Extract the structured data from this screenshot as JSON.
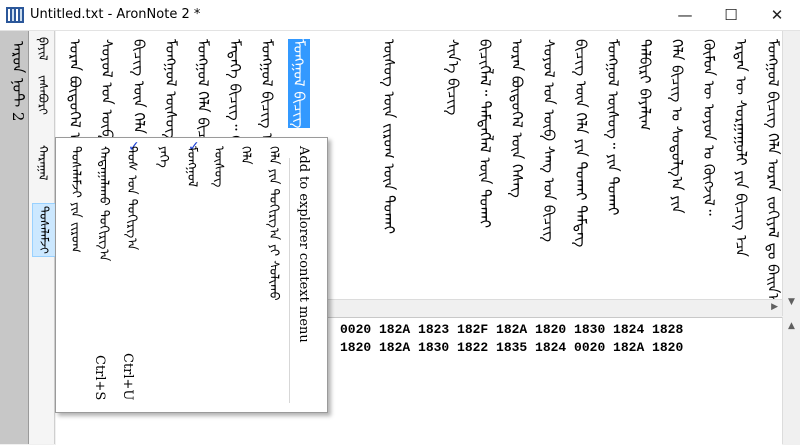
{
  "window": {
    "title": "Untitled.txt - AronNote 2 *",
    "minimize": "—",
    "maximize": "☐",
    "close": "✕"
  },
  "app": {
    "name": "ᠠᠷᠤᠨ ᠨᠣᠲ 2"
  },
  "menu": [
    "ᠹᠠᠶᠢᠯ",
    "ᠵᠠᠰᠠᠪᠤᠷᠢ",
    "ᠬᠠᠷᠠᠭᠠᠯ",
    "ᠲᠤᠰᠠᠯᠠᠮᠵᠢ"
  ],
  "editor": {
    "lines": [
      "ᠮᠣᠩᠭᠣᠯ ᠪᠢᠴᠢᠭ᠌ ᠬᠡᠯᠡ ᠤᠷᠠᠨ ᠵᠣᠬᠢᠶᠠᠯ ᠳᠤ ᠪᠠᠢᠨ᠎ᠠ",
      "ᠡᠷᠲᠡᠨ ᠦ ᠰᠤᠷᠭᠠᠭᠤᠯᠢ ᠶᠢᠨ ᠪᠢᠴᠢᠭ᠌ ᠡᠴᠡ",
      "ᠬᠦᠮᠦᠨ ᠦ ᠣᠶᠤᠨ ᠤ ᠬᠥᠭᠵᠢᠯ᠃",
      "ᠬᠡᠯᠡ ᠪᠢᠴᠢᠭ ᠤ ᠰᠤᠳᠤᠯᠭ᠎ᠠ ᠶᠢᠨ",
      "ᠲᠠᠯᠪᠢᠷᠢ ᠪᠠᠶᠠᠯᠢᠭ",
      "ᠮᠣᠩᠭᠣᠯ ᠦᠰᠦᠭ᠃ ᠶᠢᠨ ᠲᠤᠬᠠᠢ",
      "ᠪᠢᠴᠢᠭ ᠦᠨ ᠬᠡᠯᠡ ᠶᠢᠨ ᠲᠤᠬᠠᠢ ᠲᠡᠮᠳᠡᠭ",
      "ᠰᠣᠶᠣᠯ ᠤᠨ ᠥᠪ ᠰᠠᠩ ᠤᠨ ᠪᠢᠴᠢᠭ",
      "ᠤᠷᠠᠨ ᠪᠦᠲᠦᠭᠡᠯ ᠦᠨ ᠬᠡᠰᠡᠭ",
      "ᠪᠢᠴᠢᠭᠯᠡᠯ᠃ ᠲᠡᠮᠳᠡᠭᠯᠡᠯ ᠦᠨ ᠲᠤᠬᠠᠢ",
      "ᠰᠢᠨ᠎ᠡ ᠪᠢᠴᠢᠭ",
      "ᠦᠰᠦᠭ ᠦᠨ ᠵᠢᠷᠤᠭ ᠦᠨ ᠲᠤᠬᠠᠢ",
      "ᠮᠣᠩᠭᠣᠯ ᠪᠢᠴᠢᠭ ᠦᠨ",
      "ᠮᠡᠳᠡᠭᠡ ᠪᠢᠴᠢᠭ᠃ ᠬᠡᠷᠡᠭ",
      "ᠮᠣᠩᠭᠣᠯ ᠬᠡᠯᠡ ᠪᠢᠴᠢᠭ ᠦᠨ ᠰᠤᠷᠭᠠᠭᠤᠯᠢ ᠶᠢᠨ"
    ],
    "selected_line": "ᠮᠣᠩᠭᠣᠯ ᠪᠢᠴᠢᠭ"
  },
  "hex": {
    "lines": [
      "0020 182A 1823 182F 182A 1820 1830 1824 1828",
      "1820 182A 1830 1822 1835 1824 0020 182A 1820"
    ]
  },
  "context_menu": {
    "items": [
      {
        "label": "Add to explorer context menu",
        "shortcut": "",
        "checked": false
      },
      {
        "label": "ᠬᠡᠯᠡ ᠶᠢᠨ ᠲᠣᠬᠢᠷᠭ᠎ᠠ ᠶᠢ ᠰᠣᠯᠢᠬᠤ",
        "shortcut": "",
        "checked": false
      },
      {
        "label": "ᠬᠡᠯᠡ",
        "shortcut": "",
        "checked": false
      },
      {
        "label": "ᠦᠰᠦᠭ",
        "shortcut": "",
        "checked": false
      },
      {
        "label": "ᠮᠣᠩᠭᠣᠯ",
        "shortcut": "",
        "checked": true
      },
      {
        "label": "ᠶᠡᠬᠡ",
        "shortcut": "",
        "checked": false
      },
      {
        "label": "ᠳᠤᠰ ᠤᠨ ᠲᠣᠬᠢᠷᠭ᠎ᠠ",
        "shortcut": "Ctrl+U",
        "checked": true
      },
      {
        "label": "ᠬᠠᠳᠠᠭᠠᠯᠠᠬᠤ ᠲᠣᠬᠢᠷᠭ᠎ᠠ",
        "shortcut": "Ctrl+S",
        "checked": false
      },
      {
        "label": "ᠲᠤᠰᠠᠯᠠᠮᠵᠢ ᠶᠢᠨ ᠵᠢᠷᠤᠭ",
        "shortcut": "",
        "checked": false
      }
    ]
  },
  "icons": {
    "app": "app-icon",
    "check": "✓"
  },
  "colors": {
    "selection": "#3399ff",
    "check": "#1a3fd6"
  }
}
